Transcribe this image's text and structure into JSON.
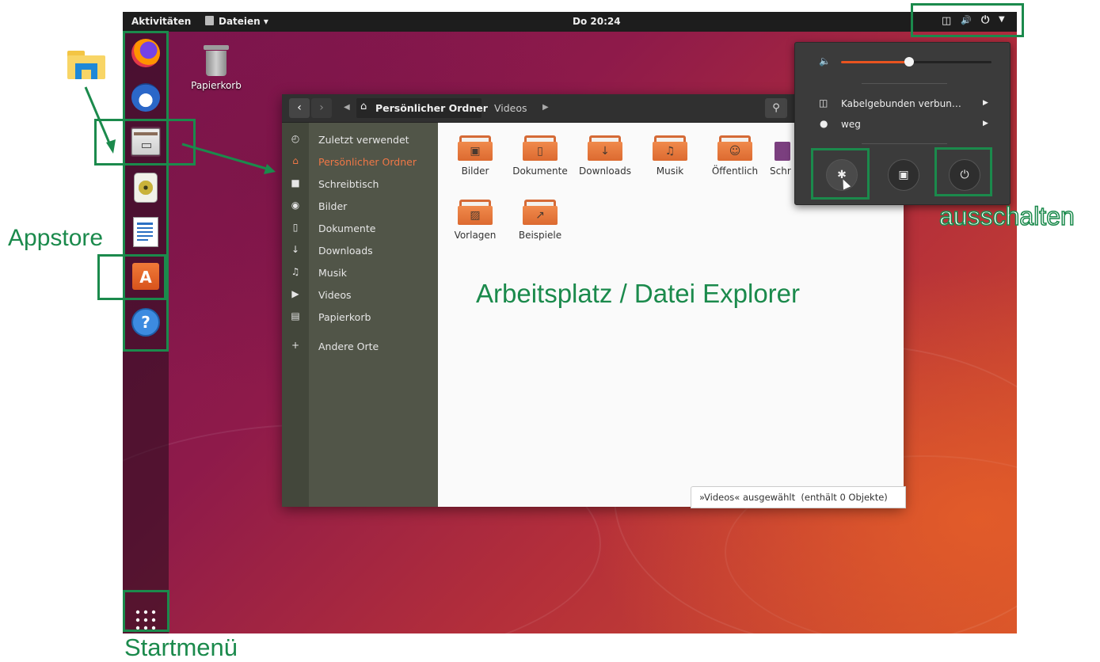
{
  "topbar": {
    "activities": "Aktivitäten",
    "app_menu": "Dateien ▾",
    "clock": "Do 20:24"
  },
  "desktop": {
    "trash_label": "Papierkorb"
  },
  "window": {
    "path_home": "Persönlicher Ordner",
    "path_current": "Videos",
    "sidebar_items": [
      {
        "label": "Zuletzt verwendet",
        "icon": "clock-icon"
      },
      {
        "label": "Persönlicher Ordner",
        "icon": "home-icon",
        "active": true
      },
      {
        "label": "Schreibtisch",
        "icon": "desktop-folder-icon"
      },
      {
        "label": "Bilder",
        "icon": "camera-icon"
      },
      {
        "label": "Dokumente",
        "icon": "document-icon"
      },
      {
        "label": "Downloads",
        "icon": "download-icon"
      },
      {
        "label": "Musik",
        "icon": "music-icon"
      },
      {
        "label": "Videos",
        "icon": "video-icon"
      },
      {
        "label": "Papierkorb",
        "icon": "trash-icon"
      },
      {
        "label": "Andere Orte",
        "icon": "plus-icon"
      }
    ],
    "folders": [
      {
        "label": "Bilder",
        "icon": "image-folder-icon"
      },
      {
        "label": "Dokumente",
        "icon": "document-folder-icon"
      },
      {
        "label": "Downloads",
        "icon": "download-folder-icon"
      },
      {
        "label": "Musik",
        "icon": "music-folder-icon"
      },
      {
        "label": "Öffentlich",
        "icon": "public-folder-icon"
      },
      {
        "label": "Schr",
        "icon": "desktop-folder-icon"
      },
      {
        "label": "Vorlagen",
        "icon": "templates-folder-icon"
      },
      {
        "label": "Beispiele",
        "icon": "examples-folder-icon"
      }
    ],
    "status": "»Videos« ausgewählt  (enthält 0 Objekte)"
  },
  "sysmenu": {
    "volume_level": 0.45,
    "network_label": "Kabelgebunden verbun…",
    "user_label": "weg"
  },
  "annotations": {
    "appstore": "Appstore",
    "startmenu": "Startmenü",
    "explorer": "Arbeitsplatz / Datei Explorer",
    "shutdown": "ausschalten"
  },
  "colors": {
    "annotation_green": "#1b8a4c",
    "ubuntu_orange": "#e95420",
    "active_sidebar": "#f07746"
  }
}
